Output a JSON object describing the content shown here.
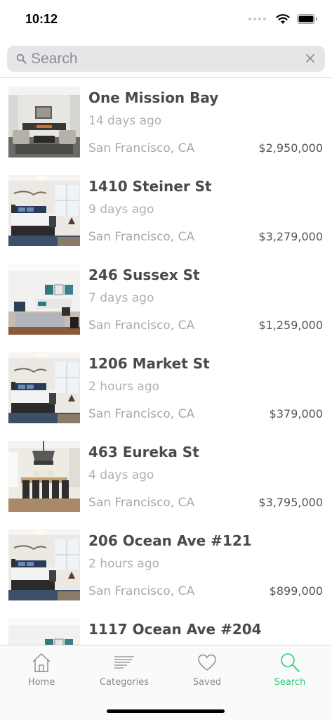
{
  "status_bar": {
    "time": "10:12"
  },
  "search": {
    "placeholder": "Search",
    "value": ""
  },
  "listings": [
    {
      "address": "One Mission Bay",
      "age": "14 days ago",
      "city": "San Francisco, CA",
      "price": "$2,950,000",
      "image": "living-room"
    },
    {
      "address": "1410 Steiner St",
      "age": "9 days ago",
      "city": "San Francisco, CA",
      "price": "$3,279,000",
      "image": "bedroom"
    },
    {
      "address": "246 Sussex St",
      "age": "7 days ago",
      "city": "San Francisco, CA",
      "price": "$1,259,000",
      "image": "bright-living-room"
    },
    {
      "address": "1206 Market St",
      "age": "2 hours ago",
      "city": "San Francisco, CA",
      "price": "$379,000",
      "image": "bedroom"
    },
    {
      "address": "463 Eureka St",
      "age": "4 days ago",
      "city": "San Francisco, CA",
      "price": "$3,795,000",
      "image": "dining-room"
    },
    {
      "address": "206 Ocean Ave #121",
      "age": "2 hours ago",
      "city": "San Francisco, CA",
      "price": "$899,000",
      "image": "bedroom"
    },
    {
      "address": "1117 Ocean Ave #204",
      "age": "",
      "city": "",
      "price": "",
      "image": "bright-living-room"
    }
  ],
  "tabs": [
    {
      "label": "Home",
      "icon": "home-icon",
      "active": false
    },
    {
      "label": "Categories",
      "icon": "categories-icon",
      "active": false
    },
    {
      "label": "Saved",
      "icon": "heart-icon",
      "active": false
    },
    {
      "label": "Search",
      "icon": "search-icon",
      "active": true
    }
  ],
  "colors": {
    "accent": "#2ecc71",
    "text": "#4a4a4a",
    "muted": "#b0b0b0"
  }
}
